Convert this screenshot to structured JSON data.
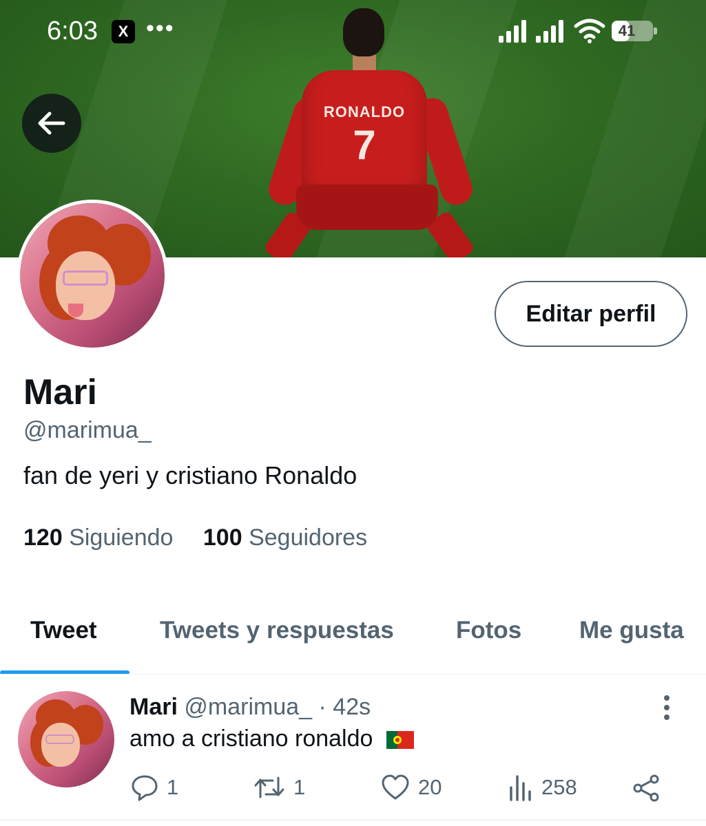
{
  "status_bar": {
    "time": "6:03",
    "app_icon": "X",
    "more_dots": "•••",
    "battery_level": "41",
    "icons": [
      "x-app-icon",
      "signal-icon",
      "signal-icon",
      "wifi-icon",
      "battery-icon"
    ]
  },
  "banner": {
    "jersey_name": "RONALDO",
    "jersey_number": "7",
    "pitch_color": "#2f6a22",
    "jersey_color": "#c81d1d"
  },
  "profile": {
    "display_name": "Mari",
    "handle": "@marimua_",
    "bio": "fan de yeri y cristiano Ronaldo",
    "edit_button_label": "Editar perfil",
    "following_count": "120",
    "following_label": "Siguiendo",
    "followers_count": "100",
    "followers_label": "Seguidores"
  },
  "tabs": [
    {
      "label": "Tweet",
      "active": true
    },
    {
      "label": "Tweets y respuestas",
      "active": false
    },
    {
      "label": "Fotos",
      "active": false
    },
    {
      "label": "Me gusta",
      "active": false
    }
  ],
  "tweet": {
    "name": "Mari",
    "handle": "@marimua_",
    "separator": "·",
    "time": "42s",
    "text": "amo a cristiano ronaldo",
    "flag_icon": "portugal-flag-icon",
    "replies": "1",
    "retweets": "1",
    "likes": "20",
    "views": "258"
  },
  "colors": {
    "accent": "#1d9bf0",
    "text_primary": "#0f1419",
    "text_secondary": "#536471",
    "border": "#eff3f4"
  }
}
